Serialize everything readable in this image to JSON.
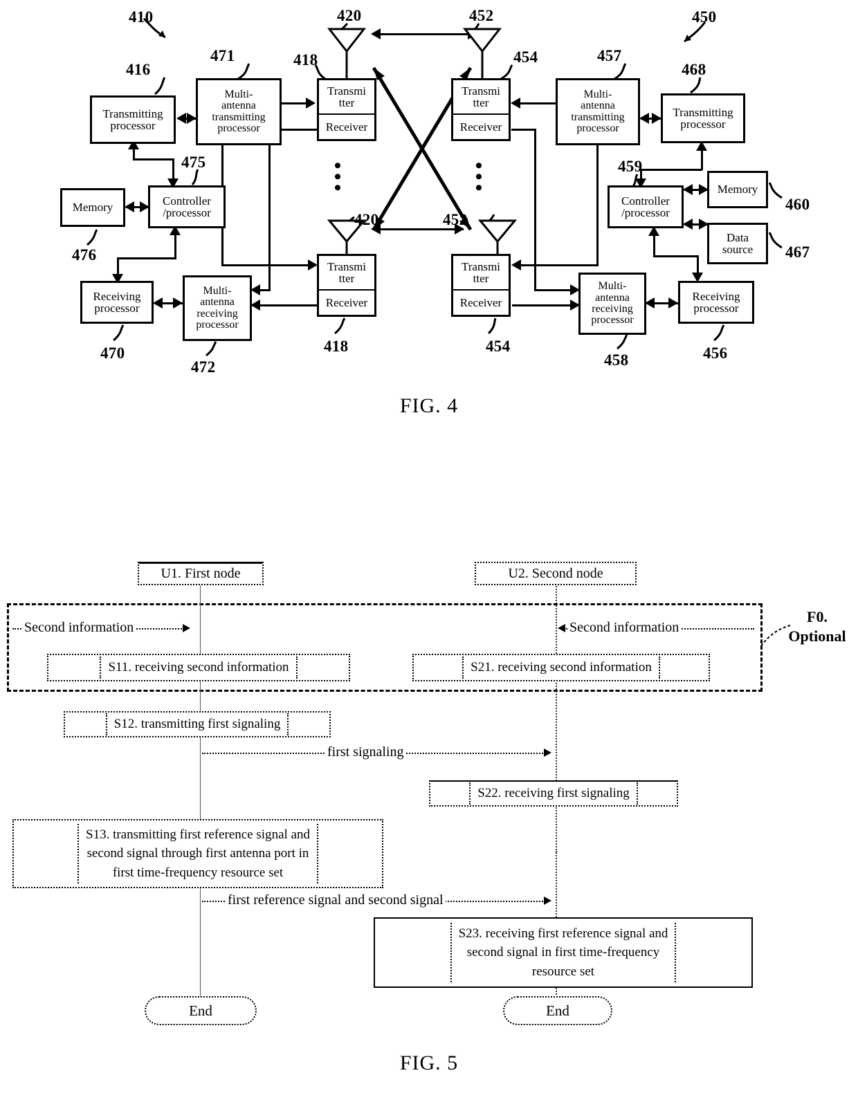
{
  "figures": [
    {
      "id": "fig4",
      "caption": "FIG. 4"
    },
    {
      "id": "fig5",
      "caption": "FIG. 5"
    }
  ],
  "fig4": {
    "caption": "FIG. 4",
    "left_node": {
      "ref": "410",
      "blocks": [
        {
          "name": "transmitting-processor",
          "ref": "416",
          "lines": [
            "Transmitting",
            "processor"
          ]
        },
        {
          "name": "multi-antenna-transmitting-processor",
          "ref": "471",
          "lines": [
            "Multi-",
            "antenna",
            "transmitting",
            "processor"
          ]
        },
        {
          "name": "controller-processor",
          "ref": "475",
          "lines": [
            "Controller",
            "/processor"
          ]
        },
        {
          "name": "memory",
          "ref": "476",
          "lines": [
            "Memory"
          ]
        },
        {
          "name": "receiving-processor",
          "ref": "470",
          "lines": [
            "Receiving",
            "processor"
          ]
        },
        {
          "name": "multi-antenna-receiving-processor",
          "ref": "472",
          "lines": [
            "Multi-",
            "antenna",
            "receiving",
            "processor"
          ]
        }
      ],
      "transceivers": [
        {
          "ref": "418",
          "tx": [
            "Transmi",
            "tter"
          ],
          "rx": "Receiver"
        },
        {
          "ref": "418",
          "tx": [
            "Transmi",
            "tter"
          ],
          "rx": "Receiver"
        }
      ],
      "antennas": [
        {
          "ref": "420"
        },
        {
          "ref": "420"
        }
      ]
    },
    "right_node": {
      "ref": "450",
      "blocks": [
        {
          "name": "transmitting-processor",
          "ref": "468",
          "lines": [
            "Transmitting",
            "processor"
          ]
        },
        {
          "name": "multi-antenna-transmitting-processor",
          "ref": "457",
          "lines": [
            "Multi-",
            "antenna",
            "transmitting",
            "processor"
          ]
        },
        {
          "name": "controller-processor",
          "ref": "459",
          "lines": [
            "Controller",
            "/processor"
          ]
        },
        {
          "name": "memory",
          "ref": "460",
          "lines": [
            "Memory"
          ]
        },
        {
          "name": "data-source",
          "ref": "467",
          "lines": [
            "Data",
            "source"
          ]
        },
        {
          "name": "receiving-processor",
          "ref": "456",
          "lines": [
            "Receiving",
            "processor"
          ]
        },
        {
          "name": "multi-antenna-receiving-processor",
          "ref": "458",
          "lines": [
            "Multi-",
            "antenna",
            "receiving",
            "processor"
          ]
        }
      ],
      "transceivers": [
        {
          "ref": "454",
          "tx": [
            "Transmi",
            "tter"
          ],
          "rx": "Receiver"
        },
        {
          "ref": "454",
          "tx": [
            "Transmi",
            "tter"
          ],
          "rx": "Receiver"
        }
      ],
      "antennas": [
        {
          "ref": "452"
        },
        {
          "ref": "452"
        }
      ]
    },
    "labels": {
      "transmitting_processor": "Transmitting",
      "processor": "processor",
      "memory": "Memory",
      "data_source_1": "Data",
      "data_source_2": "source",
      "controller": "Controller",
      "slash_processor": "/processor",
      "transmitter_1": "Transmi",
      "transmitter_2": "tter",
      "receiver": "Receiver",
      "multi": "Multi-",
      "antenna": "antenna",
      "transmitting": "transmitting",
      "receiving": "receiving",
      "receiving_processor": "Receiving",
      "dots": "•"
    },
    "refs": {
      "r410": "410",
      "r416": "416",
      "r418a": "418",
      "r418b": "418",
      "r420a": "420",
      "r420b": "420",
      "r450": "450",
      "r452a": "452",
      "r452b": "452",
      "r454a": "454",
      "r454b": "454",
      "r456": "456",
      "r457": "457",
      "r458": "458",
      "r459": "459",
      "r460": "460",
      "r467": "467",
      "r468": "468",
      "r470": "470",
      "r471": "471",
      "r472": "472",
      "r475": "475",
      "r476": "476"
    }
  },
  "fig5": {
    "caption": "FIG. 5",
    "nodes": [
      {
        "name": "first-node",
        "label": "U1. First node"
      },
      {
        "name": "second-node",
        "label": "U2. Second node"
      }
    ],
    "optional_frame": {
      "label_line1": "F0.",
      "label_line2": "Optional"
    },
    "messages": [
      {
        "name": "second-information-left",
        "label": "Second information",
        "direction": "right"
      },
      {
        "name": "second-information-right",
        "label": "Second information",
        "direction": "left"
      },
      {
        "name": "first-signaling",
        "label": "first signaling",
        "direction": "right"
      },
      {
        "name": "first-reference-signal-and-second-signal",
        "label": "first reference signal and second signal",
        "direction": "right"
      }
    ],
    "steps": [
      {
        "name": "s11",
        "label": "S11. receiving second information"
      },
      {
        "name": "s21",
        "label": "S21. receiving second information"
      },
      {
        "name": "s12",
        "label": "S12. transmitting first signaling"
      },
      {
        "name": "s22",
        "label": "S22. receiving  first signaling"
      },
      {
        "name": "s13",
        "lines": [
          "S13. transmitting first reference signal and",
          "second signal through first antenna port in",
          "first time-frequency resource set"
        ]
      },
      {
        "name": "s23",
        "lines": [
          "S23. receiving first reference signal and",
          "second signal in first time-frequency",
          "resource set"
        ]
      }
    ],
    "end_labels": [
      {
        "name": "end-left",
        "label": "End"
      },
      {
        "name": "end-right",
        "label": "End"
      }
    ]
  }
}
